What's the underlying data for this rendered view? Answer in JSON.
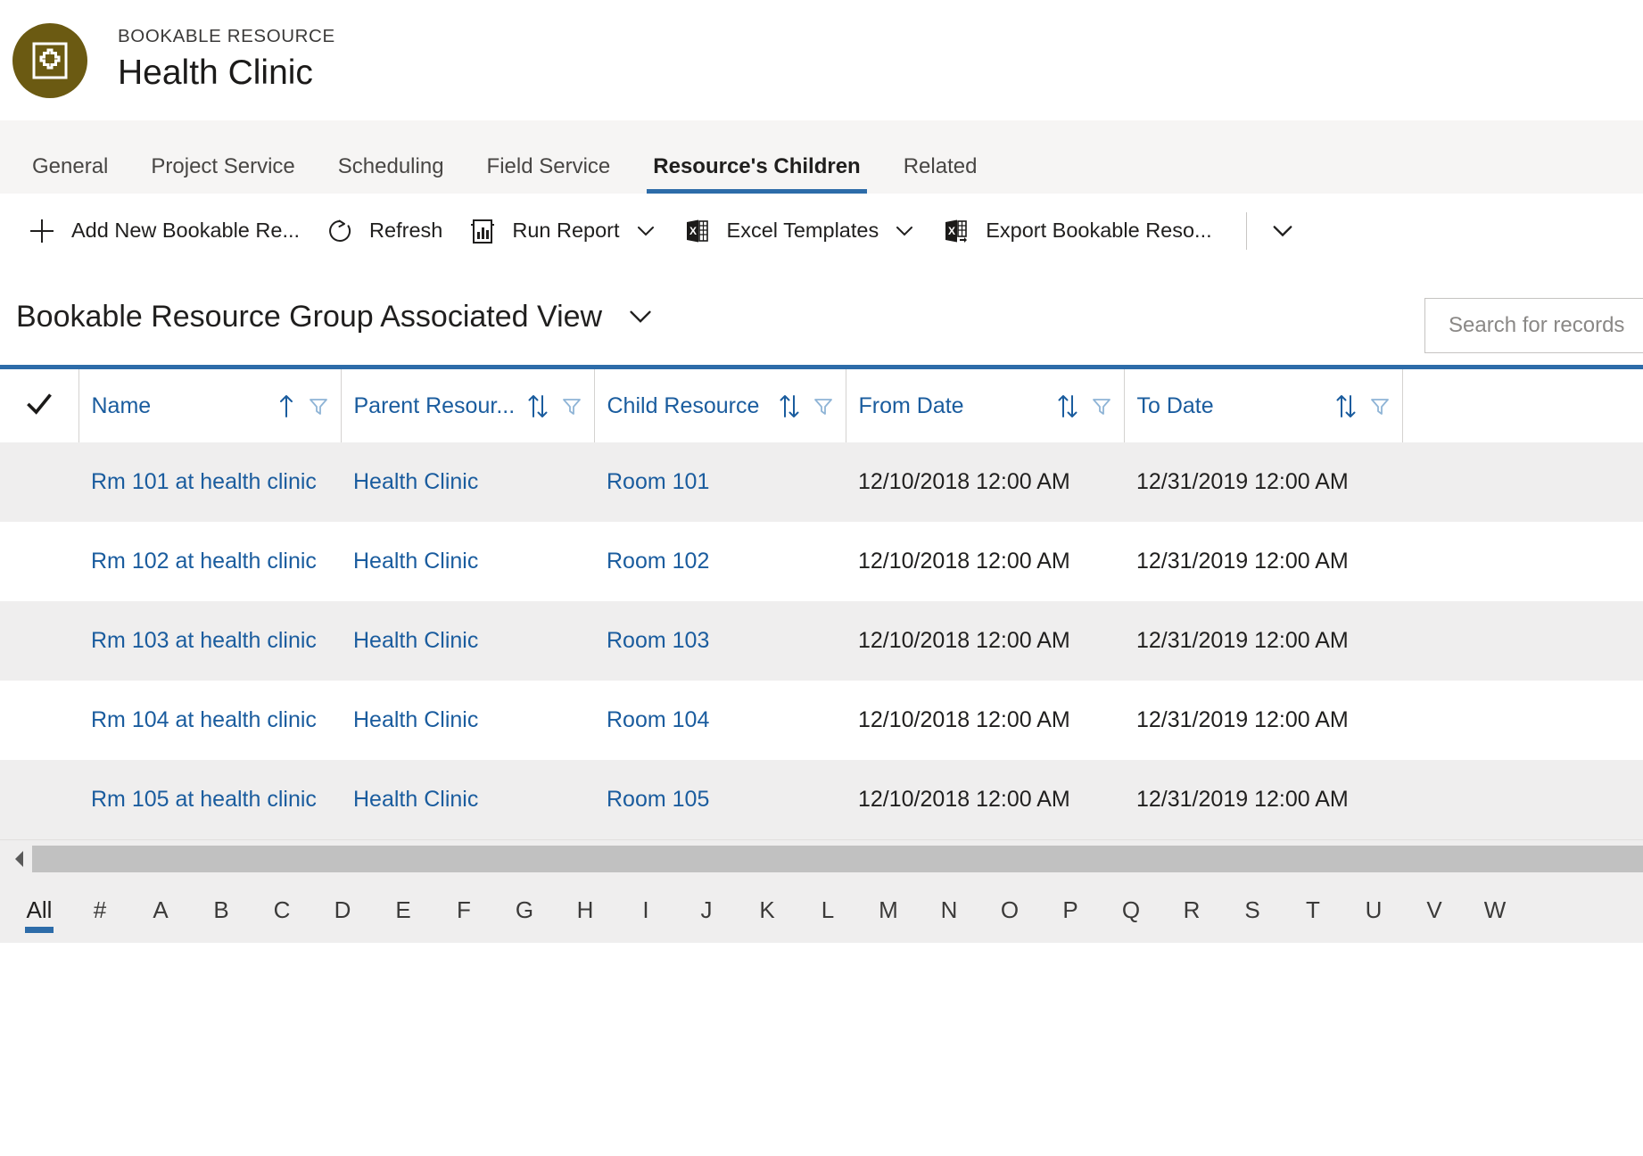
{
  "header": {
    "entity_type": "BOOKABLE RESOURCE",
    "record_title": "Health Clinic",
    "avatar_icon": "bookable-resource-icon",
    "avatar_color": "#6b5a12"
  },
  "tabs": [
    {
      "label": "General",
      "selected": false
    },
    {
      "label": "Project Service",
      "selected": false
    },
    {
      "label": "Scheduling",
      "selected": false
    },
    {
      "label": "Field Service",
      "selected": false
    },
    {
      "label": "Resource's Children",
      "selected": true
    },
    {
      "label": "Related",
      "selected": false
    }
  ],
  "command_bar": {
    "commands": [
      {
        "label": "Add New Bookable Re...",
        "icon": "plus-icon",
        "chevron": false
      },
      {
        "label": "Refresh",
        "icon": "refresh-icon",
        "chevron": false
      },
      {
        "label": "Run Report",
        "icon": "report-icon",
        "chevron": true
      },
      {
        "label": "Excel Templates",
        "icon": "excel-icon",
        "chevron": true
      },
      {
        "label": "Export Bookable Reso...",
        "icon": "excel-export-icon",
        "chevron": false
      }
    ],
    "overflow_icon": "chevron-down-icon"
  },
  "view": {
    "title": "Bookable Resource Group Associated View",
    "chevron_icon": "chevron-down-icon"
  },
  "search": {
    "placeholder": "Search for records",
    "value": ""
  },
  "grid": {
    "accent_color": "#2d6ca9",
    "header_text_color": "#1a5c9e",
    "select_all_icon": "checkmark-icon",
    "columns": [
      {
        "label": "Name",
        "sort": "asc",
        "filter": true
      },
      {
        "label": "Parent Resour...",
        "sort": "none",
        "filter": true
      },
      {
        "label": "Child Resource",
        "sort": "none",
        "filter": true
      },
      {
        "label": "From Date",
        "sort": "none",
        "filter": true
      },
      {
        "label": "To Date",
        "sort": "none",
        "filter": true
      }
    ],
    "rows": [
      {
        "name": "Rm 101 at health clinic",
        "parent_resource": "Health Clinic",
        "child_resource": "Room 101",
        "from_date": "12/10/2018 12:00 AM",
        "to_date": "12/31/2019 12:00 AM"
      },
      {
        "name": "Rm 102 at health clinic",
        "parent_resource": "Health Clinic",
        "child_resource": "Room 102",
        "from_date": "12/10/2018 12:00 AM",
        "to_date": "12/31/2019 12:00 AM"
      },
      {
        "name": "Rm 103 at health clinic",
        "parent_resource": "Health Clinic",
        "child_resource": "Room 103",
        "from_date": "12/10/2018 12:00 AM",
        "to_date": "12/31/2019 12:00 AM"
      },
      {
        "name": "Rm 104 at health clinic",
        "parent_resource": "Health Clinic",
        "child_resource": "Room 104",
        "from_date": "12/10/2018 12:00 AM",
        "to_date": "12/31/2019 12:00 AM"
      },
      {
        "name": "Rm 105 at health clinic",
        "parent_resource": "Health Clinic",
        "child_resource": "Room 105",
        "from_date": "12/10/2018 12:00 AM",
        "to_date": "12/31/2019 12:00 AM"
      }
    ]
  },
  "footer": {
    "alpha_filter": [
      {
        "label": "All",
        "selected": true
      },
      {
        "label": "#",
        "selected": false
      },
      {
        "label": "A",
        "selected": false
      },
      {
        "label": "B",
        "selected": false
      },
      {
        "label": "C",
        "selected": false
      },
      {
        "label": "D",
        "selected": false
      },
      {
        "label": "E",
        "selected": false
      },
      {
        "label": "F",
        "selected": false
      },
      {
        "label": "G",
        "selected": false
      },
      {
        "label": "H",
        "selected": false
      },
      {
        "label": "I",
        "selected": false
      },
      {
        "label": "J",
        "selected": false
      },
      {
        "label": "K",
        "selected": false
      },
      {
        "label": "L",
        "selected": false
      },
      {
        "label": "M",
        "selected": false
      },
      {
        "label": "N",
        "selected": false
      },
      {
        "label": "O",
        "selected": false
      },
      {
        "label": "P",
        "selected": false
      },
      {
        "label": "Q",
        "selected": false
      },
      {
        "label": "R",
        "selected": false
      },
      {
        "label": "S",
        "selected": false
      },
      {
        "label": "T",
        "selected": false
      },
      {
        "label": "U",
        "selected": false
      },
      {
        "label": "V",
        "selected": false
      },
      {
        "label": "W",
        "selected": false
      }
    ],
    "scroll_left_icon": "caret-left-icon"
  }
}
